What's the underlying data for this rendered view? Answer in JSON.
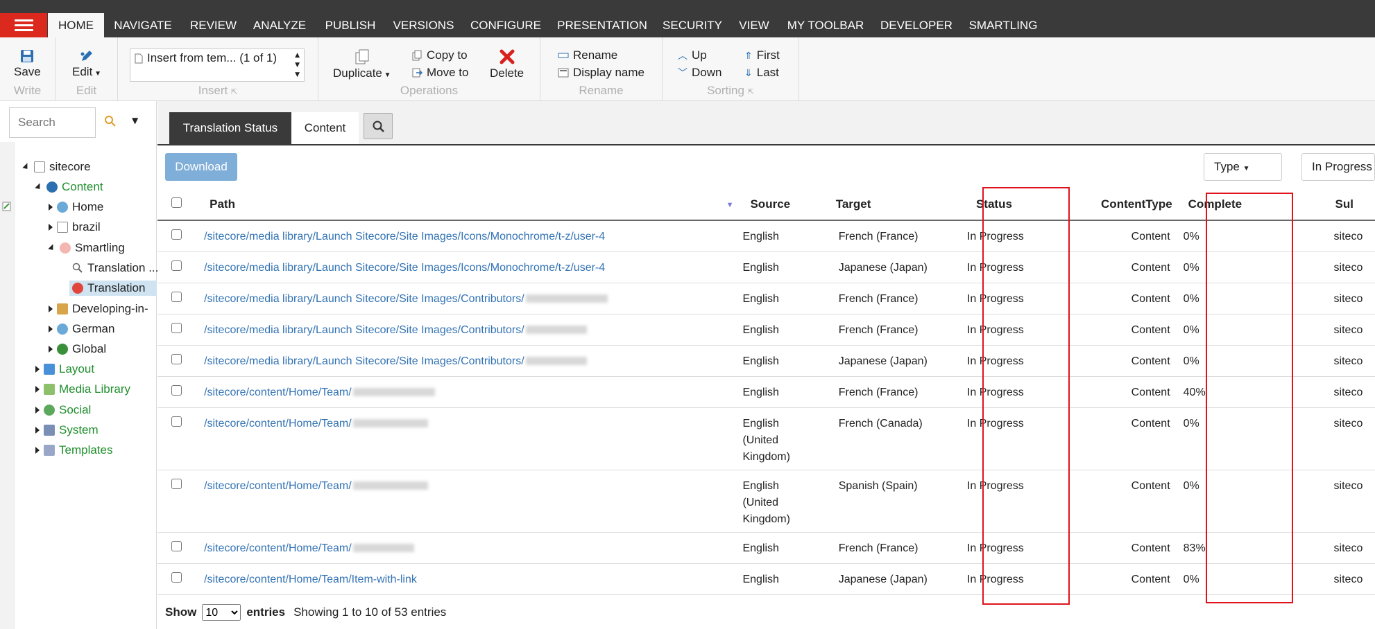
{
  "menu": {
    "tabs": [
      "HOME",
      "NAVIGATE",
      "REVIEW",
      "ANALYZE",
      "PUBLISH",
      "VERSIONS",
      "CONFIGURE",
      "PRESENTATION",
      "SECURITY",
      "VIEW",
      "MY TOOLBAR",
      "DEVELOPER",
      "SMARTLING"
    ],
    "active": "HOME"
  },
  "ribbon": {
    "save": "Save",
    "write": "Write",
    "edit": "Edit",
    "edit_group": "Edit",
    "insert_value": "Insert from tem... (1 of 1)",
    "insert_group": "Insert",
    "duplicate": "Duplicate",
    "copy_to": "Copy to",
    "move_to": "Move to",
    "delete": "Delete",
    "operations_group": "Operations",
    "rename": "Rename",
    "display_name": "Display name",
    "rename_group": "Rename",
    "up": "Up",
    "down": "Down",
    "first": "First",
    "last": "Last",
    "sorting_group": "Sorting"
  },
  "search": {
    "placeholder": "Search"
  },
  "tree": {
    "root": "sitecore",
    "content": "Content",
    "home": "Home",
    "brazil": "brazil",
    "smartling": "Smartling",
    "translation1": "Translation ...",
    "translation2": "Translation",
    "developing": "Developing-in-",
    "german": "German",
    "global": "Global",
    "layout": "Layout",
    "media_library": "Media Library",
    "social": "Social",
    "system": "System",
    "templates": "Templates"
  },
  "tabs": {
    "translation_status": "Translation Status",
    "content": "Content"
  },
  "toolbar": {
    "download": "Download",
    "type": "Type",
    "in_progress": "In Progress"
  },
  "table": {
    "headers": {
      "path": "Path",
      "source": "Source",
      "target": "Target",
      "status": "Status",
      "content_type": "ContentType",
      "complete": "Complete",
      "submitter": "Sul"
    },
    "rows": [
      {
        "path": "/sitecore/media library/Launch Sitecore/Site Images/Icons/Monochrome/t-z/user-4",
        "source": "English",
        "target": "French (France)",
        "status": "In Progress",
        "content_type": "Content",
        "complete": "0%",
        "submitter": "siteco"
      },
      {
        "path": "/sitecore/media library/Launch Sitecore/Site Images/Icons/Monochrome/t-z/user-4",
        "source": "English",
        "target": "Japanese (Japan)",
        "status": "In Progress",
        "content_type": "Content",
        "complete": "0%",
        "submitter": "siteco"
      },
      {
        "path": "/sitecore/media library/Launch Sitecore/Site Images/Contributors/",
        "source": "English",
        "target": "French (France)",
        "status": "In Progress",
        "content_type": "Content",
        "complete": "0%",
        "submitter": "siteco"
      },
      {
        "path": "/sitecore/media library/Launch Sitecore/Site Images/Contributors/",
        "source": "English",
        "target": "French (France)",
        "status": "In Progress",
        "content_type": "Content",
        "complete": "0%",
        "submitter": "siteco"
      },
      {
        "path": "/sitecore/media library/Launch Sitecore/Site Images/Contributors/",
        "source": "English",
        "target": "Japanese (Japan)",
        "status": "In Progress",
        "content_type": "Content",
        "complete": "0%",
        "submitter": "siteco"
      },
      {
        "path": "/sitecore/content/Home/Team/",
        "source": "English",
        "target": "French (France)",
        "status": "In Progress",
        "content_type": "Content",
        "complete": "40%",
        "submitter": "siteco"
      },
      {
        "path": "/sitecore/content/Home/Team/",
        "source": "English (United Kingdom)",
        "target": "French (Canada)",
        "status": "In Progress",
        "content_type": "Content",
        "complete": "0%",
        "submitter": "siteco"
      },
      {
        "path": "/sitecore/content/Home/Team/",
        "source": "English (United Kingdom)",
        "target": "Spanish (Spain)",
        "status": "In Progress",
        "content_type": "Content",
        "complete": "0%",
        "submitter": "siteco"
      },
      {
        "path": "/sitecore/content/Home/Team/",
        "source": "English",
        "target": "French (France)",
        "status": "In Progress",
        "content_type": "Content",
        "complete": "83%",
        "submitter": "siteco"
      },
      {
        "path": "/sitecore/content/Home/Team/Item-with-link",
        "source": "English",
        "target": "Japanese (Japan)",
        "status": "In Progress",
        "content_type": "Content",
        "complete": "0%",
        "submitter": "siteco"
      }
    ]
  },
  "footer": {
    "show": "Show",
    "entries_value": "10",
    "entries": "entries",
    "info": "Showing 1 to 10 of 53 entries"
  },
  "colors": {
    "accent": "#dc291e",
    "link": "#3373b4",
    "highlight": "#e0131c",
    "topbar": "#3a3a3a"
  }
}
